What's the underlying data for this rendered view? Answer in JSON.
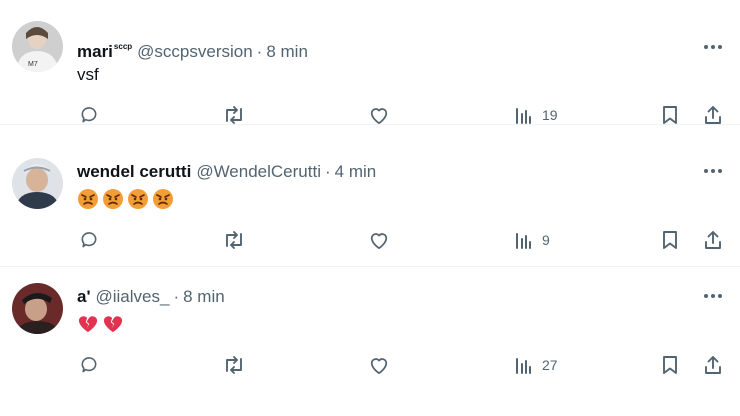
{
  "posts": [
    {
      "name": "mari",
      "name_sup": "sccp",
      "handle": "@sccpsversion",
      "separator": "·",
      "time": "8 min",
      "text": "vsf",
      "emoji": [],
      "views": "19"
    },
    {
      "name": "wendel cerutti",
      "name_sup": "",
      "handle": "@WendelCerutti",
      "separator": "·",
      "time": "4 min",
      "text": "",
      "emoji": [
        "angry-face",
        "angry-face",
        "angry-face",
        "angry-face"
      ],
      "views": "9"
    },
    {
      "name": "a'",
      "name_sup": "",
      "handle": "@iialves_",
      "separator": "·",
      "time": "8 min",
      "text": "",
      "emoji": [
        "broken-heart",
        "broken-heart"
      ],
      "views": "27"
    }
  ],
  "icons": {
    "more": "more-horizontal-icon",
    "reply": "reply-icon",
    "repost": "repost-icon",
    "like": "like-icon",
    "views": "views-icon",
    "bookmark": "bookmark-icon",
    "share": "share-icon"
  },
  "colors": {
    "text": "#0f1419",
    "secondary": "#536471",
    "divider": "#eff3f4",
    "angry_emoji": "#f29d38",
    "broken_heart": "#e0334f"
  }
}
